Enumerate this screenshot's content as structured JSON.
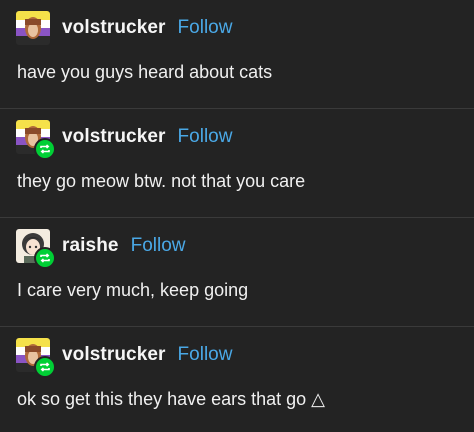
{
  "posts": [
    {
      "username": "volstrucker",
      "follow_label": "Follow",
      "text": "have you guys heard about cats",
      "reblog": false,
      "avatar_icon": "flag-avatar-icon"
    },
    {
      "username": "volstrucker",
      "follow_label": "Follow",
      "text": "they go meow btw. not that you care",
      "reblog": true,
      "avatar_icon": "flag-avatar-icon"
    },
    {
      "username": "raishe",
      "follow_label": "Follow",
      "text": "I care very much, keep going",
      "reblog": true,
      "avatar_icon": "anime-avatar-icon"
    },
    {
      "username": "volstrucker",
      "follow_label": "Follow",
      "text": "ok so get this they have ears that go △",
      "reblog": true,
      "avatar_icon": "flag-avatar-icon"
    }
  ],
  "colors": {
    "background": "#232323",
    "link": "#4aa8e6",
    "reblog_badge": "#00cf35",
    "divider": "#3a3a3a"
  }
}
